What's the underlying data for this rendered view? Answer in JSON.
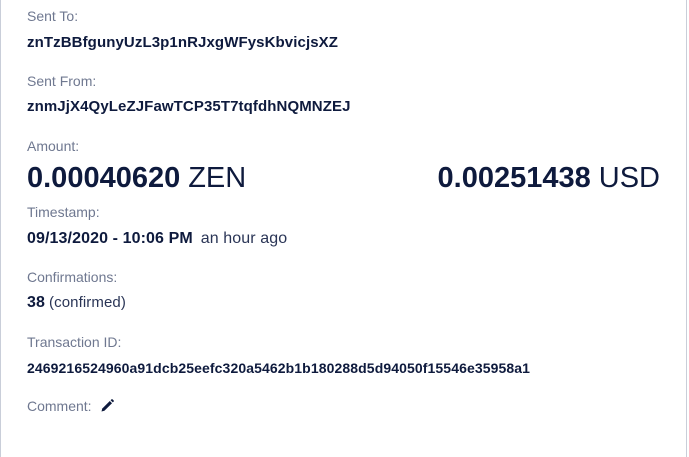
{
  "sent_to": {
    "label": "Sent To:",
    "value": "znTzBBfgunyUzL3p1nRJxgWFysKbvicjsXZ"
  },
  "sent_from": {
    "label": "Sent From:",
    "value": "znmJjX4QyLeZJFawTCP35T7tqfdhNQMNZEJ"
  },
  "amount": {
    "label": "Amount:",
    "zen_value": "0.00040620",
    "zen_unit": "ZEN",
    "usd_value": "0.00251438",
    "usd_unit": "USD"
  },
  "timestamp": {
    "label": "Timestamp:",
    "value": "09/13/2020 - 10:06 PM",
    "relative": "an hour ago"
  },
  "confirmations": {
    "label": "Confirmations:",
    "count": "38",
    "status": "(confirmed)"
  },
  "transaction_id": {
    "label": "Transaction ID:",
    "value": "2469216524960a91dcb25eefc320a5462b1b180288d5d94050f15546e35958a1"
  },
  "comment": {
    "label": "Comment:",
    "edit_icon": "pencil-icon"
  },
  "colors": {
    "text_primary": "#0e1a3d",
    "text_label": "#6f7890",
    "border": "#c9ced9"
  }
}
